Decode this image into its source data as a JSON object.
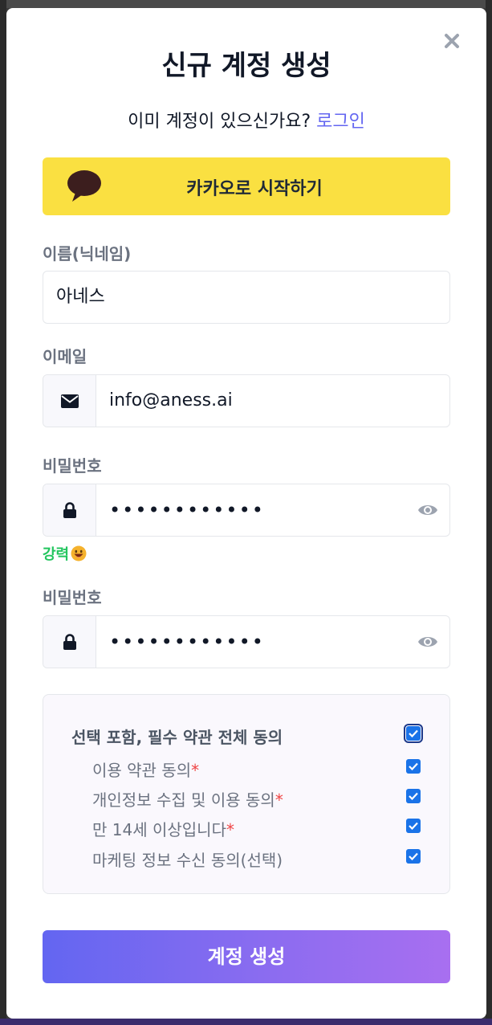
{
  "modal": {
    "title": "신규 계정 생성",
    "login_prompt": "이미 계정이 있으신가요?",
    "login_link": "로그인",
    "close_icon": "close-icon"
  },
  "kakao": {
    "label": "카카오로 시작하기",
    "icon": "speech-bubble-icon",
    "color": "#fae041"
  },
  "fields": {
    "name": {
      "label": "이름(닉네임)",
      "value": "아네스"
    },
    "email": {
      "label": "이메일",
      "value": "info@aness.ai",
      "icon": "envelope-icon"
    },
    "password": {
      "label": "비밀번호",
      "value": "••••••••••••",
      "icon": "lock-icon",
      "toggle_icon": "eye-icon"
    },
    "password_confirm": {
      "label": "비밀번호",
      "value": "••••••••••••",
      "icon": "lock-icon",
      "toggle_icon": "eye-icon"
    }
  },
  "strength": {
    "label": "강력",
    "emoji": "grinning-face-emoji",
    "color": "#22c55e"
  },
  "terms": {
    "all": {
      "label": "선택 포함, 필수 약관 전체 동의",
      "checked": true
    },
    "items": [
      {
        "label": "이용 약관 동의",
        "required_mark": "*",
        "checked": true
      },
      {
        "label": "개인정보 수집 및 이용 동의",
        "required_mark": "*",
        "checked": true
      },
      {
        "label": "만 14세 이상입니다",
        "required_mark": "*",
        "checked": true
      },
      {
        "label": "마케팅 정보 수신 동의(선택)",
        "required_mark": "",
        "checked": true
      }
    ]
  },
  "submit": {
    "label": "계정 생성"
  },
  "colors": {
    "accent": "#6366f1",
    "gradient_end": "#a86ff0",
    "required": "#ef4444"
  }
}
